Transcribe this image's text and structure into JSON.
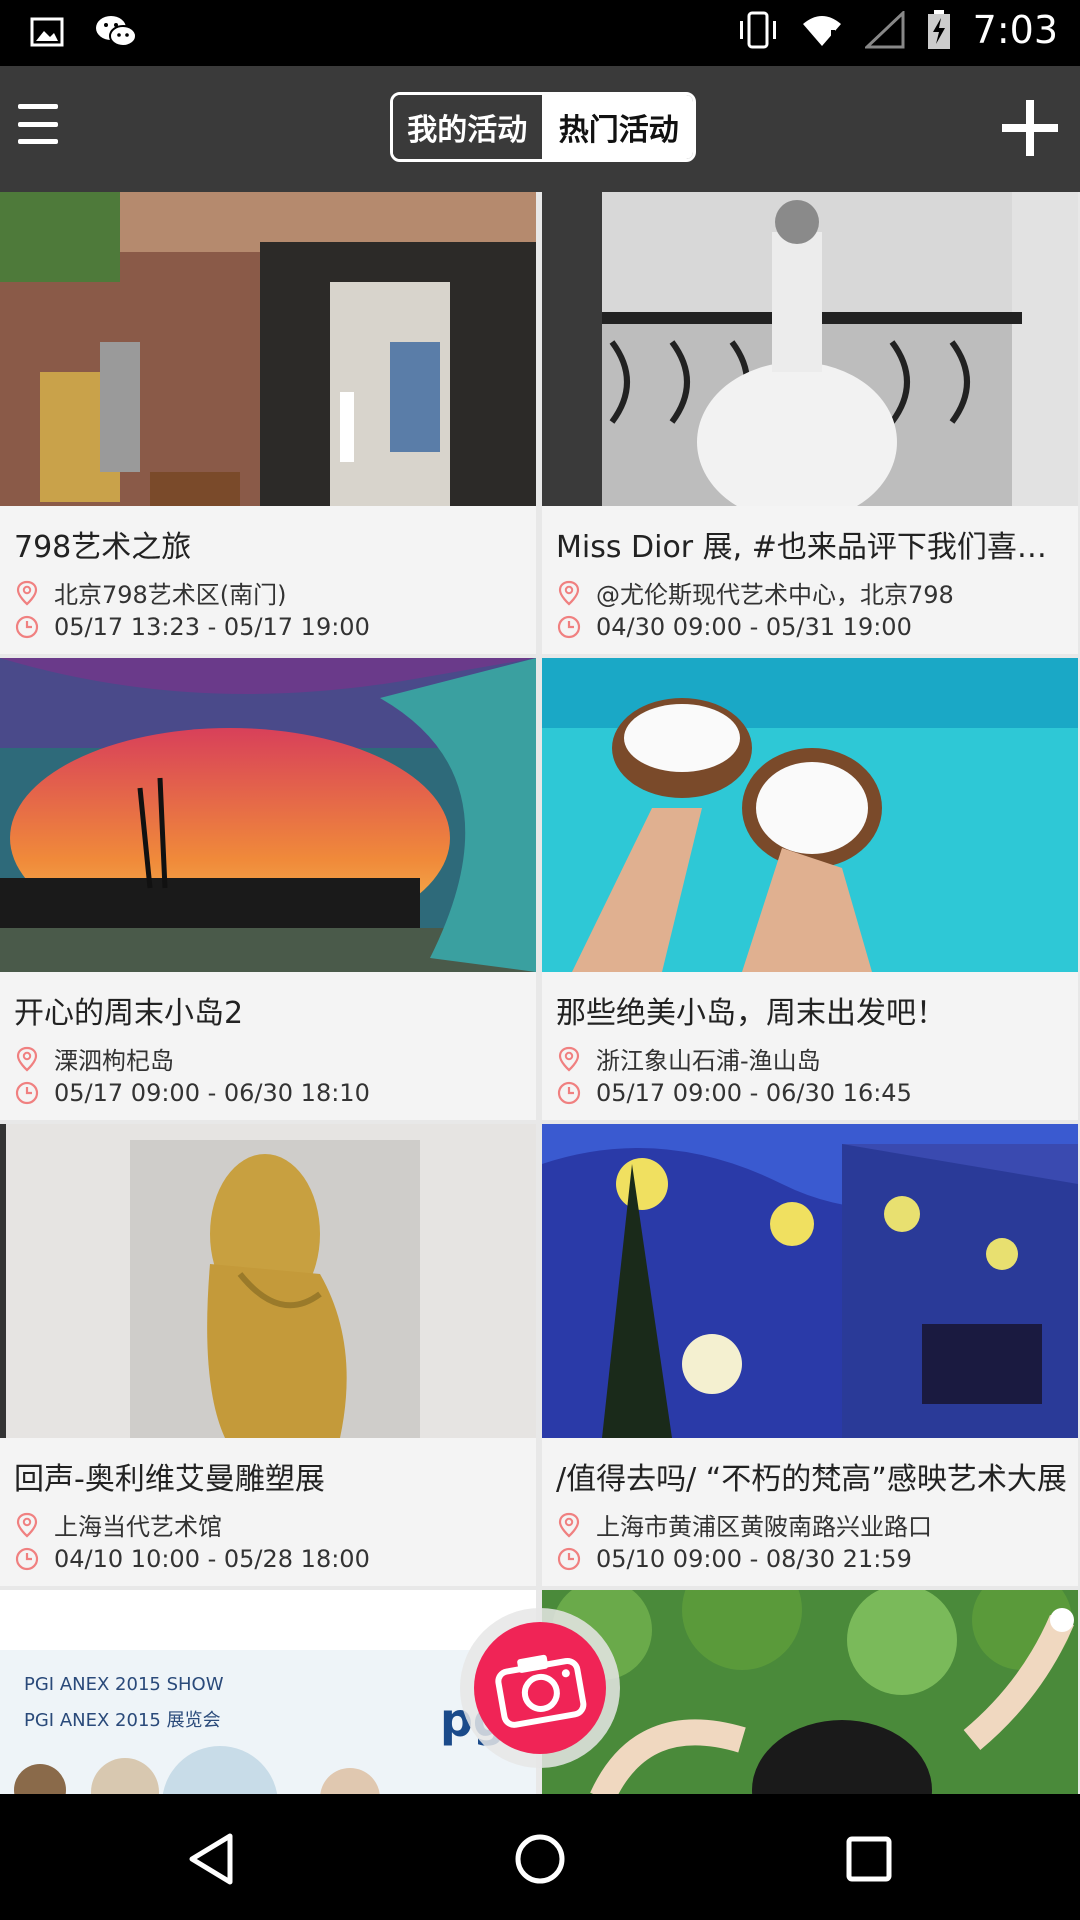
{
  "status_bar": {
    "time": "7:03",
    "icons": [
      "image-icon",
      "wechat-icon",
      "vibrate-icon",
      "wifi-icon",
      "signal-icon",
      "battery-charging-icon"
    ]
  },
  "app_bar": {
    "menu_icon": "menu-icon",
    "tabs": [
      {
        "label": "我的活动",
        "selected": false
      },
      {
        "label": "热门活动",
        "selected": true
      }
    ],
    "add_icon": "add-icon"
  },
  "events": [
    {
      "title": "798艺术之旅",
      "location": "北京798艺术区(南门)",
      "time": "05/17 13:23 - 05/17 19:00"
    },
    {
      "title": "Miss Dior 展, #也来品评下我们喜欢的作品吧",
      "location": "@尤伦斯现代艺术中心，北京798",
      "time": "04/30 09:00 - 05/31 19:00"
    },
    {
      "title": "开心的周末小岛2",
      "location": "溧泗枸杞岛",
      "time": "05/17 09:00 - 06/30 18:10"
    },
    {
      "title": "那些绝美小岛，周末出发吧！",
      "location": "浙江象山石浦-渔山岛",
      "time": "05/17 09:00 - 06/30 16:45"
    },
    {
      "title": "回声-奥利维艾曼雕塑展",
      "location": "上海当代艺术馆",
      "time": "04/10 10:00 - 05/28 18:00"
    },
    {
      "title": "/值得去吗/ “不朽的梵高”感映艺术大展",
      "location": "上海市黄浦区黄陂南路兴业路口",
      "time": "05/10 09:00 - 08/30 21:59"
    }
  ],
  "partial_card": {
    "line1": "PGI ANEX 2015 SHOW",
    "line2": "PGI ANEX 2015 展览会",
    "logo_text": "pg"
  },
  "fab": {
    "icon": "camera-icon"
  },
  "nav_bar": {
    "icons": [
      "back-icon",
      "home-icon",
      "recents-icon"
    ]
  },
  "colors": {
    "app_bar": "#3a3a3a",
    "fab": "#f02456",
    "icon_accent": "#f08080"
  }
}
